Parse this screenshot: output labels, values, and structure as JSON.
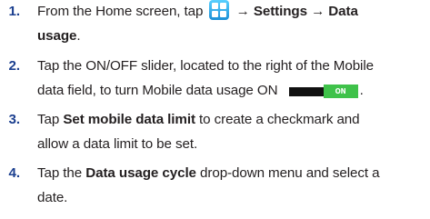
{
  "steps": [
    {
      "number": "1.",
      "line1_pre": "From the Home screen, tap",
      "line1_icon": "apps-grid-icon",
      "line1_arrow1": "→",
      "line1_bold1": "Settings",
      "line1_arrow2": "→",
      "line1_bold2": "Data",
      "line2_bold": "usage",
      "line2_post": "."
    },
    {
      "number": "2.",
      "line1": "Tap the ON/OFF slider, located to the right of the Mobile",
      "line2_pre": "data field, to turn Mobile data usage ON",
      "toggle_label": "ON",
      "line2_post": "."
    },
    {
      "number": "3.",
      "line1_pre": "Tap",
      "line1_bold": "Set mobile data limit",
      "line1_post": "to create a checkmark and",
      "line2": "allow a data limit to be set."
    },
    {
      "number": "4.",
      "line1_pre": "Tap the",
      "line1_bold": "Data usage cycle",
      "line1_post": "drop-down menu and select a",
      "line2": "date."
    }
  ],
  "colors": {
    "step_number": "#1b3f8f",
    "text": "#231f20",
    "toggle_on": "#3fc24a",
    "toggle_track": "#111111",
    "apps_icon": "#1b8fd6"
  }
}
